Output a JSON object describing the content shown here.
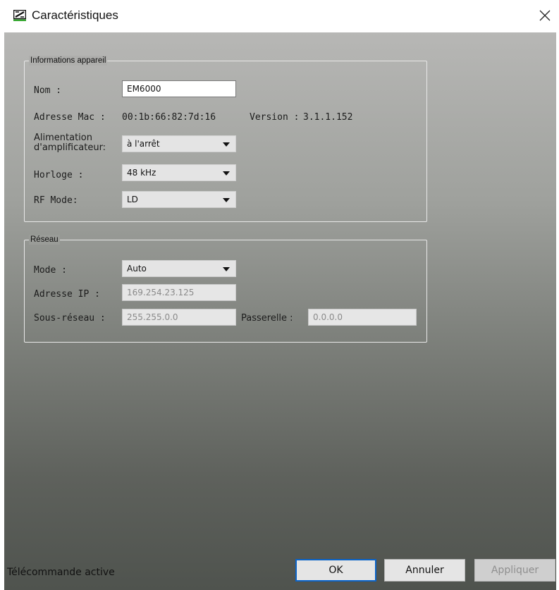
{
  "window": {
    "title": "Caractéristiques"
  },
  "device_info": {
    "legend": "Informations appareil",
    "name_label": "Nom :",
    "name_value": "EM6000",
    "mac_label": "Adresse Mac :",
    "mac_value": "00:1b:66:82:7d:16",
    "version_label": "Version :",
    "version_value": "3.1.1.152",
    "amp_label_line1": "Alimentation",
    "amp_label_line2": "d'amplificateur:",
    "amp_value": "à l'arrêt",
    "clock_label": "Horloge :",
    "clock_value": "48 kHz",
    "rf_label": "RF Mode:",
    "rf_value": "LD"
  },
  "network": {
    "legend": "Réseau",
    "mode_label": "Mode :",
    "mode_value": "Auto",
    "ip_label": "Adresse IP :",
    "ip_value": "169.254.23.125",
    "subnet_label": "Sous-réseau :",
    "subnet_value": "255.255.0.0",
    "gateway_label": "Passerelle :",
    "gateway_value": "0.0.0.0"
  },
  "footer": {
    "status": "Télécommande active",
    "ok_label": "OK",
    "cancel_label": "Annuler",
    "apply_label": "Appliquer"
  },
  "colors": {
    "accent": "#0a63c8",
    "logo_green": "#3aaa35"
  },
  "icons": {
    "app": "sennheiser-logo-icon",
    "close": "close-icon",
    "dropdown": "chevron-down-icon"
  }
}
